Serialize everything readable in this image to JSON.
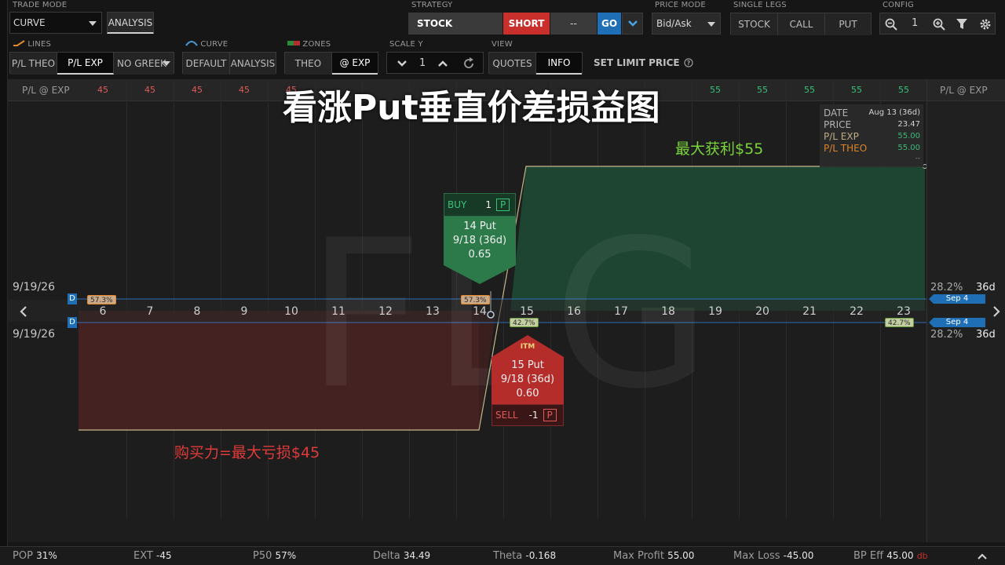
{
  "toolbar": {
    "trade_mode": {
      "label": "TRADE MODE",
      "value": "CURVE",
      "button": "ANALYSIS"
    },
    "strategy": {
      "label": "STRATEGY",
      "stock": "STOCK",
      "short": "SHORT",
      "dash": "--",
      "go": "GO"
    },
    "price_mode": {
      "label": "PRICE MODE",
      "value": "Bid/Ask"
    },
    "single_legs": {
      "label": "SINGLE LEGS",
      "items": [
        "STOCK",
        "CALL",
        "PUT"
      ]
    },
    "config": {
      "label": "CONFIG",
      "zoom": "1"
    },
    "lines": {
      "label": "LINES",
      "items": [
        "P/L THEO",
        "P/L EXP",
        "NO GREEK"
      ]
    },
    "curve": {
      "label": "CURVE",
      "items": [
        "DEFAULT",
        "ANALYSIS"
      ]
    },
    "zones": {
      "label": "ZONES",
      "items": [
        "THEO",
        "@ EXP"
      ]
    },
    "scale_y": {
      "label": "SCALE Y",
      "value": "1"
    },
    "view": {
      "label": "VIEW",
      "items": [
        "QUOTES",
        "INFO"
      ]
    },
    "set_limit_price": "SET LIMIT PRICE"
  },
  "chart": {
    "title": "看涨Put垂直价差损益图",
    "watermark": "FLG",
    "header_label": "P/L @ EXP",
    "header_values": [
      "45",
      "45",
      "45",
      "45",
      "45",
      "",
      "",
      "",
      "",
      "",
      "",
      "",
      "",
      "55",
      "55",
      "55",
      "55",
      "55"
    ],
    "x_ticks": [
      "6",
      "7",
      "8",
      "9",
      "10",
      "11",
      "12",
      "13",
      "14",
      "15",
      "16",
      "17",
      "18",
      "19",
      "20",
      "21",
      "22",
      "23"
    ],
    "date_top": "9/19/26",
    "date_bottom": "9/19/26",
    "pct_left_top": "57.3%",
    "pct_mid_top": "57.3%",
    "pct_mid_bottom": "42.7%",
    "pct_right_bottom": "42.7%",
    "max_profit_label": "最大获利$55",
    "max_loss_label": "购买力=最大亏损$45",
    "info": {
      "date_label": "DATE",
      "date_value": "Aug 13 (36d)",
      "price_label": "PRICE",
      "price_value": "23.47",
      "plexp_label": "P/L EXP",
      "plexp_value": "55.00",
      "pltheo_label": "P/L THEO",
      "pltheo_value": "55.00",
      "more": "--"
    },
    "buy_ticket": {
      "side": "BUY",
      "qty": "1",
      "type": "P",
      "strike": "14 Put",
      "exp": "9/18 (36d)",
      "price": "0.65"
    },
    "sell_ticket": {
      "badge": "ITM",
      "strike": "15 Put",
      "exp": "9/18 (36d)",
      "price": "0.60",
      "side": "SELL",
      "qty": "-1",
      "type": "P"
    }
  },
  "right_panel": {
    "header": "P/L @ EXP",
    "top_pct": "28.2%",
    "top_days": "36d",
    "top_date": "Sep 4",
    "bottom_pct": "28.2%",
    "bottom_days": "36d",
    "bottom_date": "Sep 4"
  },
  "stats": [
    {
      "label": "POP",
      "value": "31%"
    },
    {
      "label": "EXT",
      "value": "-45"
    },
    {
      "label": "P50",
      "value": "57%"
    },
    {
      "label": "Delta",
      "value": "34.49"
    },
    {
      "label": "Theta",
      "value": "-0.168"
    },
    {
      "label": "Max Profit",
      "value": "55.00"
    },
    {
      "label": "Max Loss",
      "value": "-45.00"
    },
    {
      "label": "BP Eff",
      "value": "45.00",
      "suffix": "db"
    }
  ],
  "colors": {
    "profit_green": "#1f4a35",
    "loss_red": "#4a2424",
    "short_red": "#c9302c",
    "go_blue": "#1e6fb5",
    "label_green": "#7ad33b",
    "label_red": "#e03a3a"
  }
}
